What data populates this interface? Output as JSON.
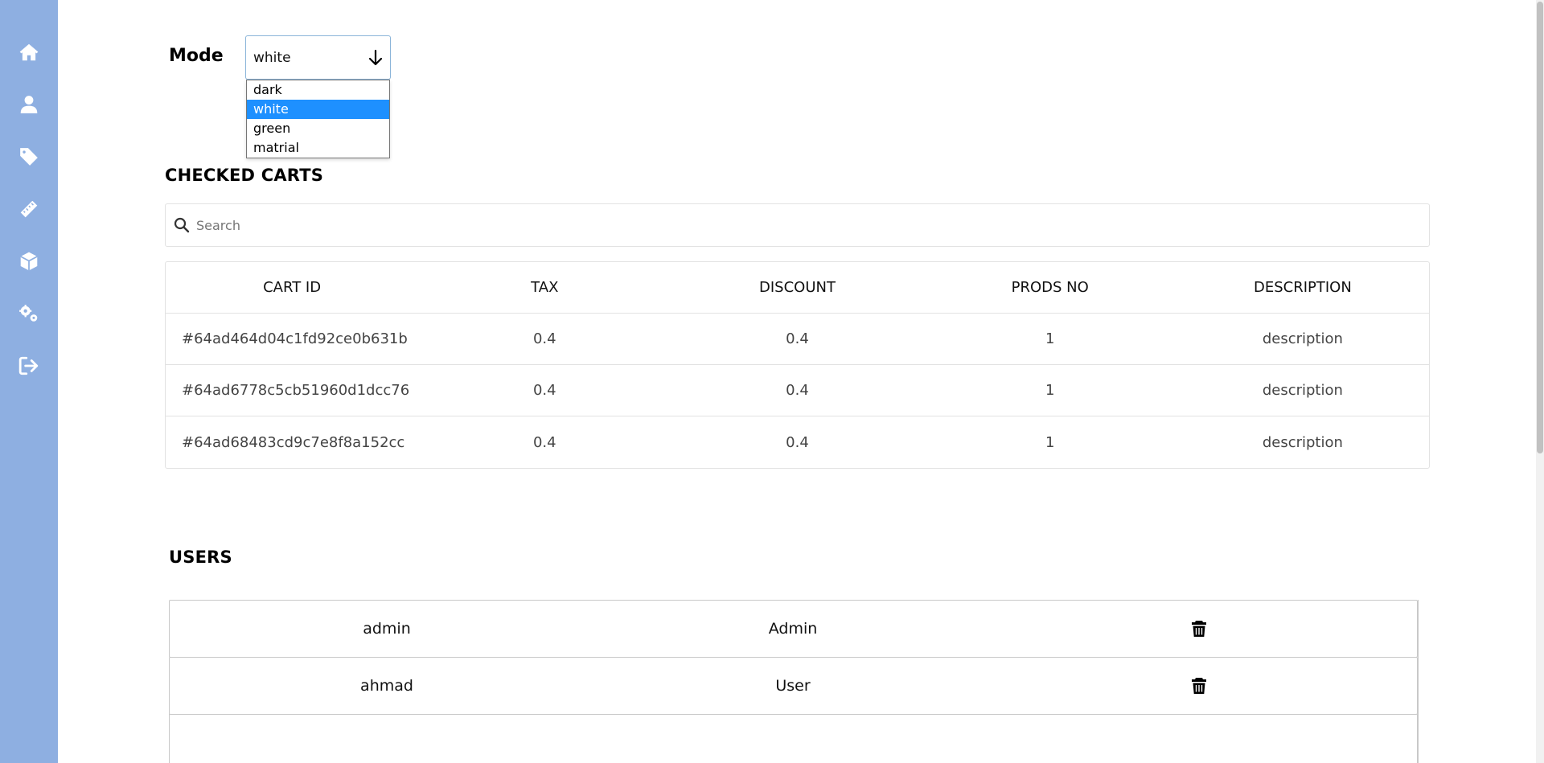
{
  "sidebar": {
    "items": [
      {
        "name": "home",
        "icon": "home-icon"
      },
      {
        "name": "users",
        "icon": "user-icon"
      },
      {
        "name": "tags",
        "icon": "tag-icon"
      },
      {
        "name": "measure",
        "icon": "ruler-icon"
      },
      {
        "name": "products",
        "icon": "box-icon"
      },
      {
        "name": "settings",
        "icon": "gears-icon"
      },
      {
        "name": "logout",
        "icon": "logout-icon"
      }
    ],
    "background": "#8eafe1"
  },
  "mode": {
    "label": "Mode",
    "selected": "white",
    "options": [
      "dark",
      "white",
      "green",
      "matrial"
    ],
    "highlight_color": "#1e90ff"
  },
  "carts": {
    "title": "CHECKED CARTS",
    "search_placeholder": "Search",
    "columns": [
      "CART ID",
      "TAX",
      "DISCOUNT",
      "PRODS NO",
      "DESCRIPTION"
    ],
    "rows": [
      {
        "id": "#64ad464d04c1fd92ce0b631b",
        "tax": "0.4",
        "discount": "0.4",
        "prods": "1",
        "description": "description"
      },
      {
        "id": "#64ad6778c5cb51960d1dcc76",
        "tax": "0.4",
        "discount": "0.4",
        "prods": "1",
        "description": "description"
      },
      {
        "id": "#64ad68483cd9c7e8f8a152cc",
        "tax": "0.4",
        "discount": "0.4",
        "prods": "1",
        "description": "description"
      }
    ]
  },
  "users": {
    "title": "USERS",
    "rows": [
      {
        "username": "admin",
        "role": "Admin",
        "action_icon": "trash-icon"
      },
      {
        "username": "ahmad",
        "role": "User",
        "action_icon": "trash-icon"
      }
    ]
  }
}
